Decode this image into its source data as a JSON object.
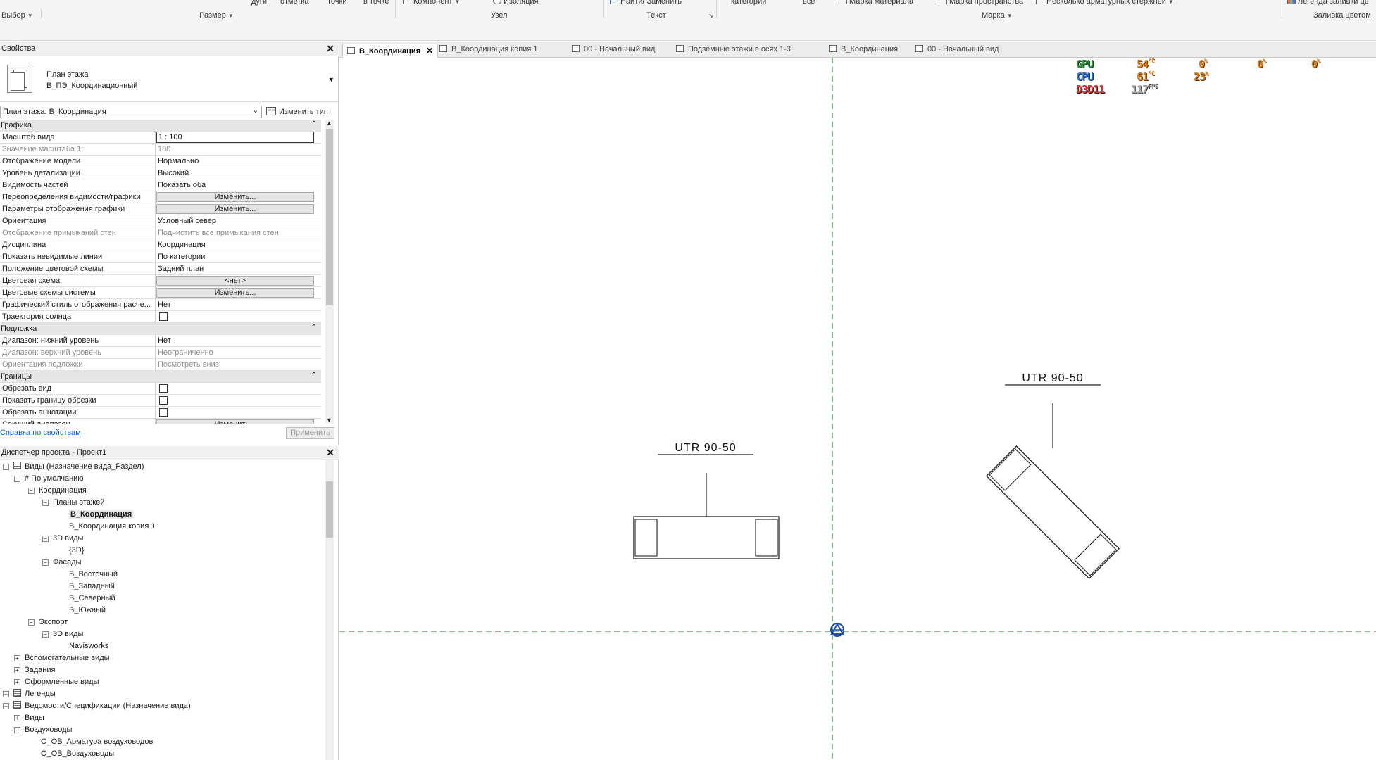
{
  "ribbon": {
    "row1": {
      "arcs": "дуги",
      "mark": "отметка",
      "points": "точки",
      "at_point": "в точке",
      "component": "Компонент",
      "isolation": "Изоляция",
      "find_replace": "Найти/ Заменить",
      "categories": "категории",
      "all": "все",
      "material_tag": "Марка материала",
      "space_tag": "Марка пространства",
      "multi_rebar": "Несколько  арматурных стержней",
      "color_fill_legend": "Легенда заливки цв"
    },
    "groups": {
      "select": "Выбор",
      "dimension": "Размер",
      "detail": "Узел",
      "text": "Текст",
      "tag": "Марка",
      "color_fill": "Заливка цветом"
    }
  },
  "properties": {
    "title": "Свойства",
    "type_line1": "План этажа",
    "type_line2": "В_ПЭ_Координационный",
    "instance_selector": "План этажа: В_Координация",
    "edit_type": "Изменить тип",
    "help_link": "Справка по свойствам",
    "apply": "Применить",
    "rows": [
      {
        "kind": "section",
        "k": "Графика"
      },
      {
        "kind": "input",
        "k": "Масштаб вида",
        "v": "1 : 100"
      },
      {
        "kind": "dim",
        "k": "Значение масштаба    1:",
        "v": "100"
      },
      {
        "kind": "text",
        "k": "Отображение модели",
        "v": "Нормально"
      },
      {
        "kind": "text",
        "k": "Уровень детализации",
        "v": "Высокий"
      },
      {
        "kind": "text",
        "k": "Видимость частей",
        "v": "Показать оба"
      },
      {
        "kind": "button",
        "k": "Переопределения видимости/графики",
        "v": "Изменить..."
      },
      {
        "kind": "button",
        "k": "Параметры отображения графики",
        "v": "Изменить..."
      },
      {
        "kind": "text",
        "k": "Ориентация",
        "v": "Условный север"
      },
      {
        "kind": "dim",
        "k": "Отображение примыканий стен",
        "v": "Подчистить все примыкания стен"
      },
      {
        "kind": "text",
        "k": "Дисциплина",
        "v": "Координация"
      },
      {
        "kind": "text",
        "k": "Показать невидимые линии",
        "v": "По категории"
      },
      {
        "kind": "text",
        "k": "Положение цветовой схемы",
        "v": "Задний план"
      },
      {
        "kind": "button",
        "k": "Цветовая схема",
        "v": "<нет>"
      },
      {
        "kind": "button",
        "k": "Цветовые схемы системы",
        "v": "Изменить..."
      },
      {
        "kind": "text",
        "k": "Графический стиль отображения расче...",
        "v": "Нет"
      },
      {
        "kind": "check",
        "k": "Траектория солнца",
        "v": ""
      },
      {
        "kind": "section",
        "k": "Подложка"
      },
      {
        "kind": "text",
        "k": "Диапазон: нижний уровень",
        "v": "Нет"
      },
      {
        "kind": "dim",
        "k": "Диапазон: верхний уровень",
        "v": "Неограниченно"
      },
      {
        "kind": "dim",
        "k": "Ориентация подложки",
        "v": "Посмотреть вниз"
      },
      {
        "kind": "section",
        "k": "Границы"
      },
      {
        "kind": "check",
        "k": "Обрезать вид",
        "v": ""
      },
      {
        "kind": "check",
        "k": "Показать границу обрезки",
        "v": ""
      },
      {
        "kind": "check",
        "k": "Обрезать аннотации",
        "v": ""
      },
      {
        "kind": "button",
        "k": "Секущий диапазон",
        "v": "Изменить..."
      }
    ]
  },
  "browser": {
    "title": "Диспетчер проекта - Проект1",
    "nodes": [
      {
        "d": 0,
        "tog": "-",
        "icon": true,
        "label": "Виды (Назначение вида_Раздел)"
      },
      {
        "d": 1,
        "tog": "-",
        "label": "# По умолчанию"
      },
      {
        "d": 2,
        "tog": "-",
        "label": "Координация"
      },
      {
        "d": 3,
        "tog": "-",
        "label": "Планы этажей"
      },
      {
        "d": 4,
        "label": "В_Координация",
        "sel": true
      },
      {
        "d": 4,
        "label": "В_Координация копия 1"
      },
      {
        "d": 3,
        "tog": "-",
        "label": "3D виды"
      },
      {
        "d": 4,
        "label": "{3D}"
      },
      {
        "d": 3,
        "tog": "-",
        "label": "Фасады"
      },
      {
        "d": 4,
        "label": "В_Восточный"
      },
      {
        "d": 4,
        "label": "В_Западный"
      },
      {
        "d": 4,
        "label": "В_Северный"
      },
      {
        "d": 4,
        "label": "В_Южный"
      },
      {
        "d": 2,
        "tog": "-",
        "label": "Экспорт"
      },
      {
        "d": 3,
        "tog": "-",
        "label": "3D виды"
      },
      {
        "d": 4,
        "label": "Navisworks"
      },
      {
        "d": 1,
        "tog": "+",
        "label": "Вспомогательные виды"
      },
      {
        "d": 1,
        "tog": "+",
        "label": "Задания"
      },
      {
        "d": 1,
        "tog": "+",
        "label": "Оформленные виды"
      },
      {
        "d": 0,
        "tog": "+",
        "icon": true,
        "label": "Легенды"
      },
      {
        "d": 0,
        "tog": "-",
        "icon": true,
        "label": "Ведомости/Спецификации (Назначение вида)"
      },
      {
        "d": 1,
        "tog": "+",
        "label": "Виды"
      },
      {
        "d": 1,
        "tog": "-",
        "label": "Воздуховоды"
      },
      {
        "d": 2,
        "label": "О_ОВ_Арматура воздуховодов"
      },
      {
        "d": 2,
        "label": "О_ОВ_Воздуховоды"
      }
    ]
  },
  "tabs": [
    {
      "label": "В_Координация",
      "active": true
    },
    {
      "label": "В_Координация копия 1"
    },
    {
      "label": "00 - Начальный вид"
    },
    {
      "label": "Подземные этажи в осях 1-3"
    },
    {
      "label": "В_Координация"
    },
    {
      "label": "00 - Начальный вид"
    }
  ],
  "canvas": {
    "tag1": "UTR 90-50",
    "tag2": "UTR 90-50",
    "grid_color": "#2e9a3e",
    "symbol_color": "#1f4fa8"
  },
  "overlay": {
    "gpu_label": "GPU",
    "gpu_temp": "54",
    "gpu_usage1": "0",
    "gpu_usage2": "0",
    "gpu_usage3": "0",
    "cpu_label": "CPU",
    "cpu_temp": "61",
    "cpu_usage": "23",
    "api_label": "D3D11",
    "fps": "117",
    "fps_unit": "FPS",
    "temp_unit": "°C",
    "pct_unit": "%"
  }
}
